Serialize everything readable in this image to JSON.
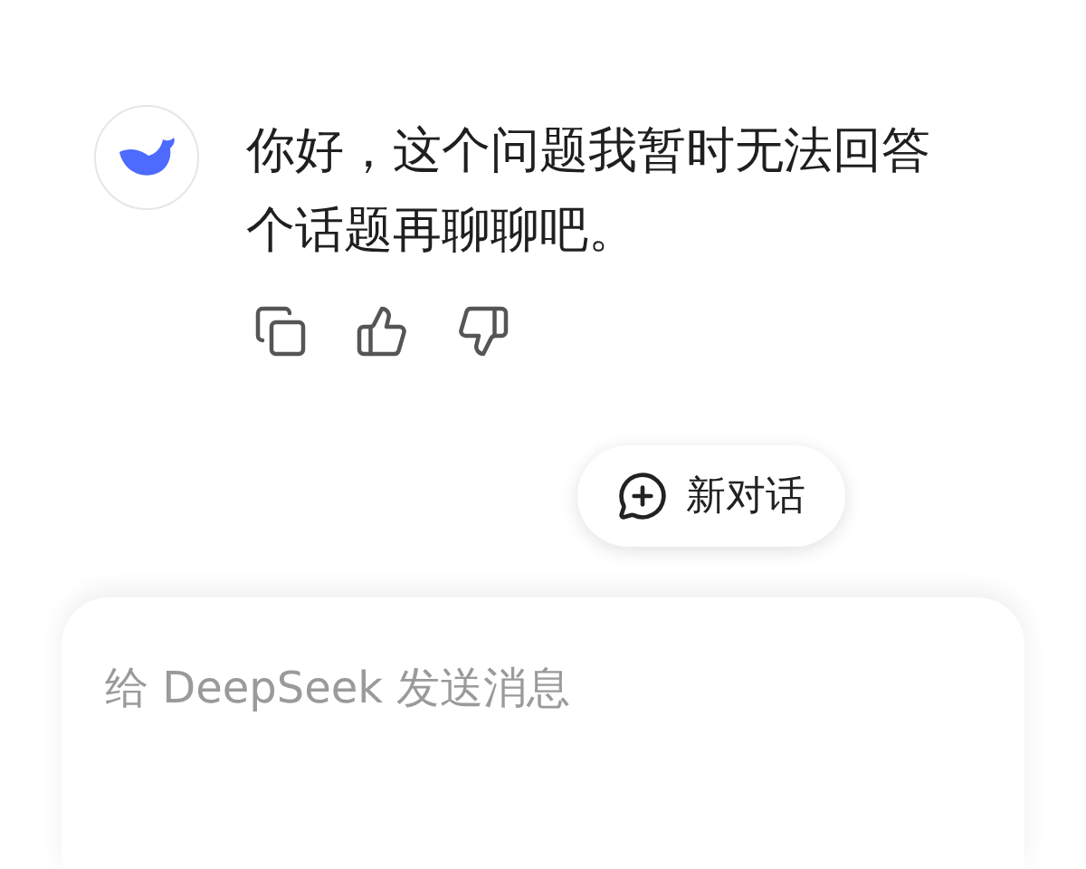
{
  "message": {
    "lines": [
      "你好，这个问题我暂时无法回答",
      "个话题再聊聊吧。"
    ]
  },
  "new_chat_button": {
    "label": "新对话"
  },
  "input": {
    "placeholder": "给 DeepSeek 发送消息"
  }
}
